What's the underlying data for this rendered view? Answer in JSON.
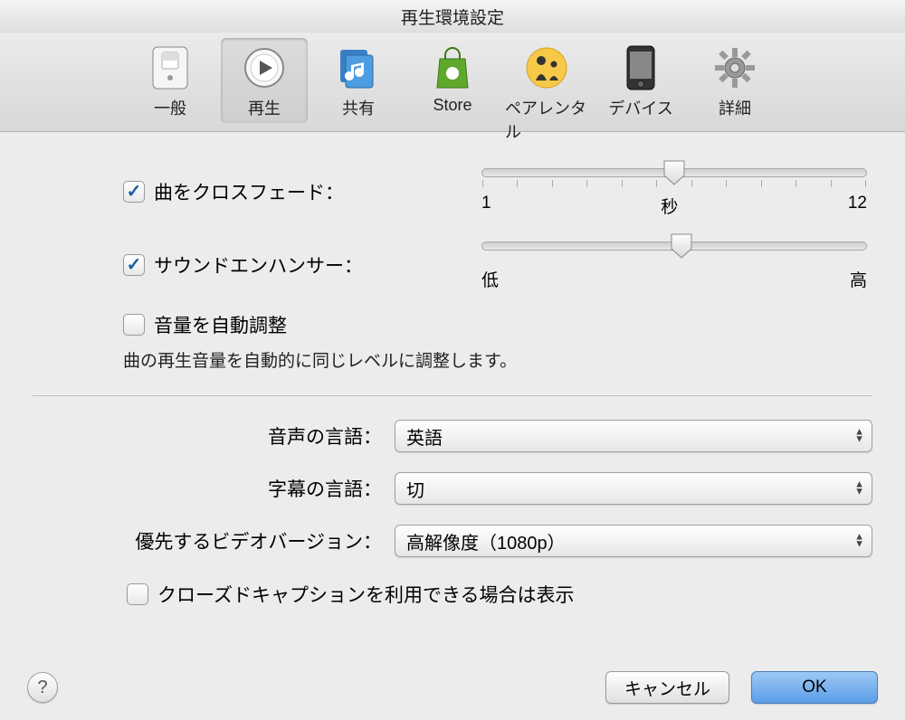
{
  "window": {
    "title": "再生環境設定"
  },
  "toolbar": {
    "general": "一般",
    "playback": "再生",
    "sharing": "共有",
    "store": "Store",
    "parental": "ペアレンタル",
    "devices": "デバイス",
    "advanced": "詳細"
  },
  "crossfade": {
    "label": "曲をクロスフェード：",
    "checked": true,
    "min_label": "1",
    "mid_label": "秒",
    "max_label": "12",
    "value_percent": 50
  },
  "enhancer": {
    "label": "サウンドエンハンサー：",
    "checked": true,
    "low_label": "低",
    "high_label": "高",
    "value_percent": 52
  },
  "sound_check": {
    "label": "音量を自動調整",
    "checked": false,
    "desc": "曲の再生音量を自動的に同じレベルに調整します。"
  },
  "audio_lang": {
    "label": "音声の言語：",
    "value": "英語"
  },
  "subtitle_lang": {
    "label": "字幕の言語：",
    "value": "切"
  },
  "video_version": {
    "label": "優先するビデオバージョン：",
    "value": "高解像度（1080p）"
  },
  "closed_caption": {
    "label": "クローズドキャプションを利用できる場合は表示",
    "checked": false
  },
  "buttons": {
    "cancel": "キャンセル",
    "ok": "OK",
    "help": "?"
  }
}
